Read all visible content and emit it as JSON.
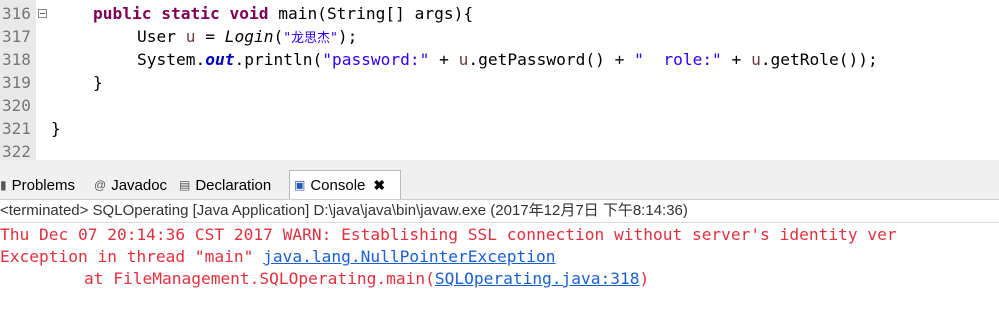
{
  "editor": {
    "lines": [
      {
        "num": "316",
        "fold": true
      },
      {
        "num": "317"
      },
      {
        "num": "318"
      },
      {
        "num": "319"
      },
      {
        "num": "320"
      },
      {
        "num": "321"
      },
      {
        "num": "322"
      }
    ],
    "l316": {
      "public": "public",
      "static": "static",
      "void": "void",
      "main": "main(",
      "string_type": "String",
      "rest": "[] args){"
    },
    "l317": {
      "type": "User",
      "var": "u",
      "assign": " = ",
      "call": "Login",
      "open": "(",
      "arg": "\"龙思杰\"",
      "close": ");"
    },
    "l318": {
      "system": "System.",
      "out": "out",
      "println": ".println(",
      "str1": "\"password:\"",
      "plus1": " + ",
      "u1": "u",
      "call1": ".getPassword() + ",
      "str2": "\"  role:\"",
      "plus2": " + ",
      "u2": "u",
      "call2": ".getRole());"
    },
    "l319": {
      "brace": "}"
    },
    "l321": {
      "brace": "}"
    }
  },
  "tabs": [
    {
      "label": "Problems",
      "icon": "problems-icon"
    },
    {
      "label": "Javadoc",
      "icon": "javadoc-icon"
    },
    {
      "label": "Declaration",
      "icon": "declaration-icon"
    },
    {
      "label": "Console",
      "icon": "console-icon",
      "close": "✖"
    }
  ],
  "console": {
    "header": "<terminated> SQLOperating [Java Application] D:\\java\\java\\bin\\javaw.exe (2017年12月7日 下午8:14:36)",
    "line1": "Thu Dec 07 20:14:36 CST 2017 WARN: Establishing SSL connection without server's identity ver",
    "line2_prefix": "Exception in thread \"main\" ",
    "line2_link": "java.lang.NullPointerException",
    "line3_prefix": "\tat FileManagement.SQLOperating.main(",
    "line3_link": "SQLOperating.java:318",
    "line3_suffix": ")"
  },
  "colors": {
    "keyword": "#7f0055",
    "string": "#2a00ff",
    "error": "#e0303f",
    "link": "#1a5fd1"
  }
}
